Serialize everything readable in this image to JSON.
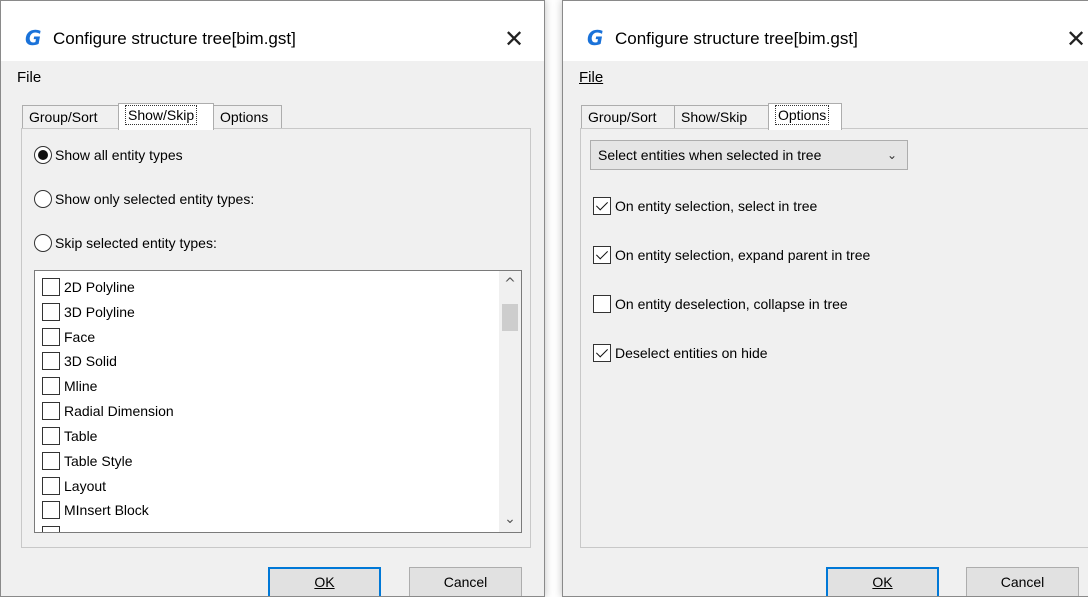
{
  "dialog_left": {
    "title": "Configure structure tree[bim.gst]",
    "close": "✕",
    "menu": {
      "file": "File"
    },
    "tabs": [
      {
        "label": "Group/Sort",
        "active": false
      },
      {
        "label": "Show/Skip",
        "active": true
      },
      {
        "label": "Options",
        "active": false
      }
    ],
    "radios": [
      {
        "label": "Show all entity types",
        "checked": true
      },
      {
        "label": "Show only selected entity types:",
        "checked": false
      },
      {
        "label": "Skip selected entity types:",
        "checked": false
      }
    ],
    "entity_types": [
      "2D Polyline",
      "3D Polyline",
      "Face",
      "3D Solid",
      "Mline",
      "Radial Dimension",
      "Table",
      "Table Style",
      "Layout",
      "MInsert Block"
    ],
    "scroll": {
      "up": "^",
      "down": "⌄"
    },
    "buttons": {
      "ok": "OK",
      "cancel": "Cancel"
    }
  },
  "dialog_right": {
    "title": "Configure structure tree[bim.gst]",
    "close": "✕",
    "menu": {
      "file": "File"
    },
    "tabs": [
      {
        "label": "Group/Sort",
        "active": false
      },
      {
        "label": "Show/Skip",
        "active": false
      },
      {
        "label": "Options",
        "active": true
      }
    ],
    "combo": {
      "value": "Select entities when selected in tree",
      "arrow": "⌄"
    },
    "options": [
      {
        "label": "On entity selection, select in tree",
        "checked": true
      },
      {
        "label": "On entity selection, expand parent in tree",
        "checked": true
      },
      {
        "label": "On entity deselection, collapse in tree",
        "checked": false
      },
      {
        "label": "Deselect entities on hide",
        "checked": true
      }
    ],
    "buttons": {
      "ok": "OK",
      "cancel": "Cancel"
    }
  },
  "colors": {
    "accent": "#0078d7",
    "app_icon": "#1a72d9",
    "dialog_bg": "#f0f0f0"
  },
  "icons": {
    "app": "G",
    "app_name": "gstarcad-logo-icon"
  }
}
